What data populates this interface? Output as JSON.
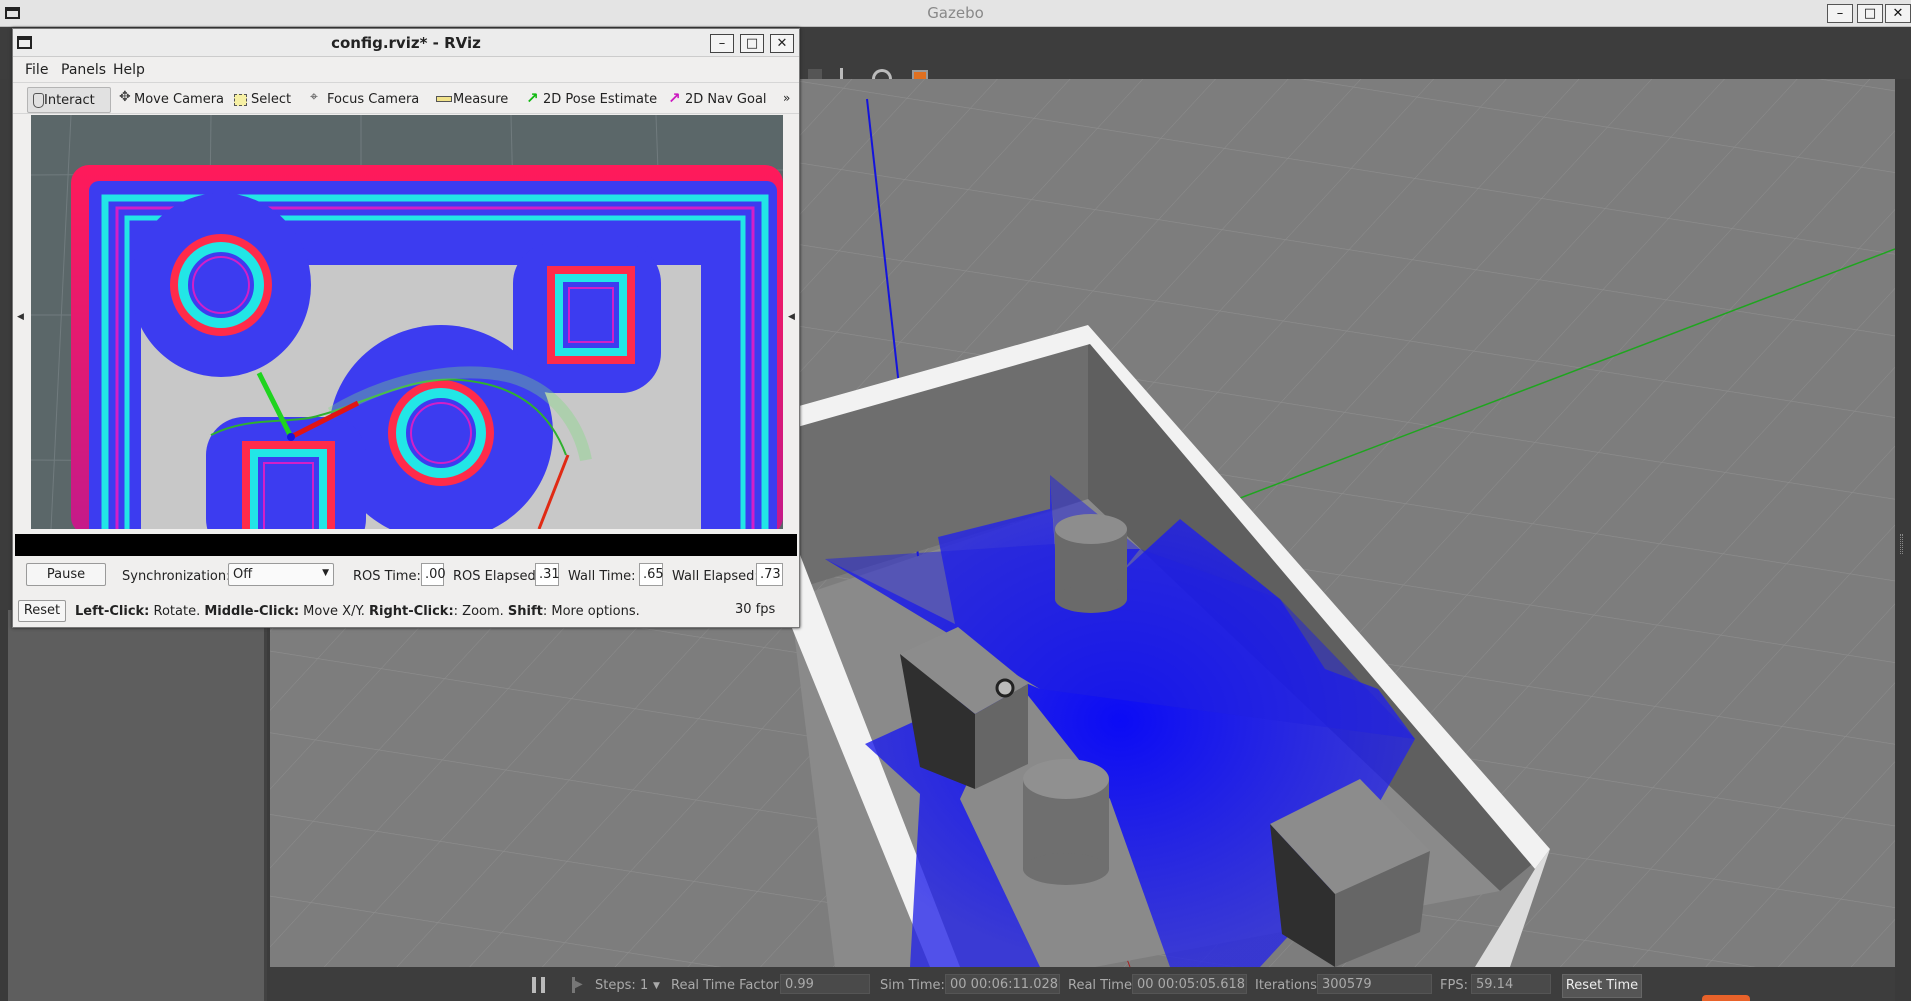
{
  "gazebo": {
    "title": "Gazebo",
    "bottom": {
      "steps_label": "Steps:",
      "steps_value": "1",
      "rtf_label": "Real Time Factor:",
      "rtf_value": "0.99",
      "sim_time_label": "Sim Time:",
      "sim_time_value": "00 00:06:11.028",
      "real_time_label": "Real Time:",
      "real_time_value": "00 00:05:05.618",
      "iterations_label": "Iterations:",
      "iterations_value": "300579",
      "fps_label": "FPS:",
      "fps_value": "59.14",
      "reset_time": "Reset Time"
    }
  },
  "rviz": {
    "title": "config.rviz* - RViz",
    "menu": {
      "file": "File",
      "panels": "Panels",
      "help": "Help"
    },
    "tools": {
      "interact": "Interact",
      "move_camera": "Move Camera",
      "select": "Select",
      "focus_camera": "Focus Camera",
      "measure": "Measure",
      "pose_estimate": "2D Pose Estimate",
      "nav_goal": "2D Nav Goal"
    },
    "time": {
      "pause": "Pause",
      "sync_label": "Synchronization:",
      "sync_value": "Off",
      "ros_time_label": "ROS Time:",
      "ros_time_value": ".00",
      "ros_elapsed_label": "ROS Elapsed:",
      "ros_elapsed_value": ".31",
      "wall_time_label": "Wall Time:",
      "wall_time_value": ".65",
      "wall_elapsed_label": "Wall Elapsed:",
      "wall_elapsed_value": ".73"
    },
    "status": {
      "reset": "Reset",
      "left_click": "Left-Click:",
      "left_click_action": " Rotate. ",
      "middle_click": "Middle-Click:",
      "middle_click_action": " Move X/Y. ",
      "right_click": "Right-Click:",
      "right_click_action": ": Zoom. ",
      "shift": "Shift",
      "shift_action": ": More options.",
      "fps": "30 fps"
    }
  },
  "colors": {
    "costmap_blue": "#3c3cf0",
    "inflation_cyan": "#22e6e6",
    "lethal_magenta": "#d21fc8",
    "scan_blue": "#2424e8"
  }
}
